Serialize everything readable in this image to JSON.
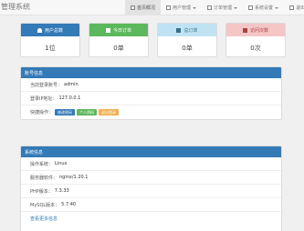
{
  "navbar": {
    "brand": "管理系统",
    "items": [
      {
        "label": "首页概况",
        "active": true,
        "icon": "home-icon",
        "dropdown": false
      },
      {
        "label": "用户管理",
        "active": false,
        "icon": "user-icon",
        "dropdown": true
      },
      {
        "label": "订单管理",
        "active": false,
        "icon": "list-icon",
        "dropdown": true
      },
      {
        "label": "系统设置",
        "active": false,
        "icon": "gear-icon",
        "dropdown": true
      },
      {
        "label": "退出",
        "active": false,
        "icon": "logout-icon",
        "dropdown": false
      }
    ]
  },
  "stats": [
    {
      "title": "用户总数",
      "value": "1位",
      "color": "#337ab7",
      "icon": "user-icon"
    },
    {
      "title": "今日订单",
      "value": "0单",
      "color": "#5cb85c",
      "icon": "flag-icon"
    },
    {
      "title": "总订单",
      "value": "0单",
      "color": "#bfe3f3",
      "icon": "cart-icon"
    },
    {
      "title": "访问次数",
      "value": "0次",
      "color": "#f5c6c6",
      "icon": "grid-icon"
    }
  ],
  "account_panel": {
    "title": "账号信息",
    "rows": [
      {
        "label": "当前登录账号：",
        "value": "admin"
      },
      {
        "label": "登录IP地址：",
        "value": "127.0.0.1"
      }
    ],
    "actions_label": "快捷操作：",
    "buttons": [
      {
        "label": "修改密码",
        "color": "#337ab7"
      },
      {
        "label": "个人资料",
        "color": "#5cb85c"
      },
      {
        "label": "退出登录",
        "color": "#f0ad4e"
      }
    ]
  },
  "system_panel": {
    "title": "系统信息",
    "rows": [
      {
        "label": "操作系统：",
        "value": "Linux"
      },
      {
        "label": "服务器软件：",
        "value": "nginx/1.20.1"
      },
      {
        "label": "PHP版本：",
        "value": "7.3.33"
      },
      {
        "label": "MySQL版本：",
        "value": "5.7.40"
      }
    ],
    "link": "查看更多信息"
  }
}
